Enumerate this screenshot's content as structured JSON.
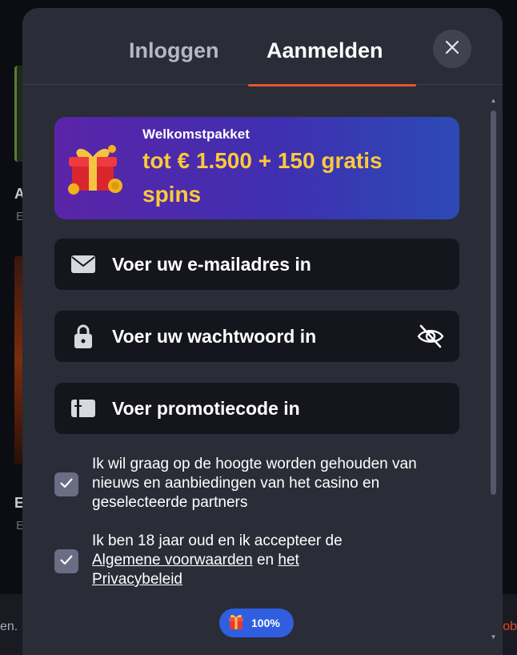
{
  "tabs": [
    {
      "label": "Inloggen",
      "active": false
    },
    {
      "label": "Aanmelden",
      "active": true
    }
  ],
  "banner": {
    "kicker": "Welkomstpakket",
    "headline": "tot € 1.500 + 150 gratis spins"
  },
  "form": {
    "email_placeholder": "Voer uw e-mailadres in",
    "password_placeholder": "Voer uw wachtwoord in",
    "promo_placeholder": "Voer promotiecode in"
  },
  "consents": [
    {
      "checked": true,
      "text": "Ik wil graag op de hoogte worden gehouden van nieuws en aanbiedingen van het casino en geselecteerde partners"
    },
    {
      "checked": true,
      "text_prefix": "Ik ben 18 jaar oud en ik accepteer de",
      "link_terms": "Algemene voorwaarden",
      "connector": "en",
      "link_privacy_1": "het",
      "link_privacy_2": "Privacybeleid"
    }
  ],
  "bonus_progress": {
    "value_label": "100%",
    "fraction": 1.0
  },
  "background": {
    "card_a_letter": "A",
    "card_a_sub": "E",
    "card_b_letter": "E",
    "card_b_sub": "E",
    "bottom_left": "en. .",
    "bottom_right": "ob"
  },
  "colors": {
    "modal_bg": "#2a2c37",
    "input_bg": "#15161d",
    "accent_underline": "#e4572e",
    "banner_gold": "#ffc93a",
    "checkbox": "#6b6d85",
    "pill": "#2f5fe0"
  },
  "icons": [
    "close-icon",
    "gift-icon",
    "mail-icon",
    "lock-icon",
    "eye-off-icon",
    "promo-card-icon",
    "check-icon"
  ]
}
